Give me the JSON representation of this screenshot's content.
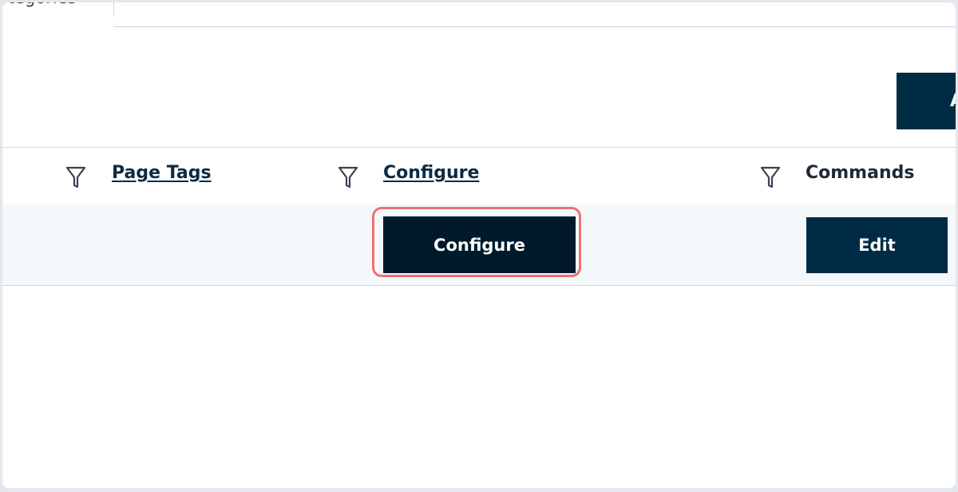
{
  "tabs": {
    "active_label": "ategories"
  },
  "toolbar": {
    "add_label": "A"
  },
  "grid": {
    "columns": [
      {
        "label": "Page Tags",
        "sortable": true
      },
      {
        "label": "Configure",
        "sortable": true
      },
      {
        "label": "Commands",
        "sortable": false
      }
    ],
    "row": {
      "configure_label": "Configure",
      "edit_label": "Edit"
    }
  },
  "icons": {
    "filter": "filter-icon"
  },
  "colors": {
    "primary_button": "#002b45",
    "highlight_border": "#f07070",
    "row_background": "#f4f8fb",
    "border": "#cfdde8"
  }
}
